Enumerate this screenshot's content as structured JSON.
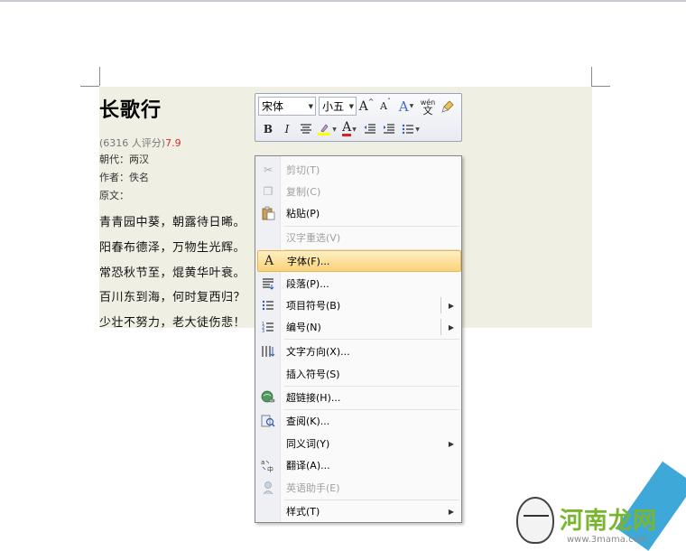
{
  "document": {
    "title": "长歌行",
    "rating_prefix": "(6316 人评分)",
    "rating_score": "7.9",
    "dynasty": "朝代：两汉",
    "author": "作者：佚名",
    "original_label": "原文：",
    "lines": [
      "青青园中葵，朝露待日晞。",
      "阳春布德泽，万物生光辉。",
      "常恐秋节至，焜黄华叶衰。",
      "百川东到海，何时复西归？",
      "少壮不努力，老大徒伤悲！"
    ]
  },
  "mini_toolbar": {
    "font_name": "宋体",
    "font_size": "小五",
    "grow_font": "A",
    "shrink_font": "A",
    "text_style": "A",
    "phonetic": "wén",
    "bold": "B",
    "italic": "I",
    "font_color_glyph": "A"
  },
  "context_menu": {
    "items": [
      {
        "label": "剪切(T)",
        "icon": "scissors-icon",
        "disabled": true
      },
      {
        "label": "复制(C)",
        "icon": "copy-icon",
        "disabled": true
      },
      {
        "label": "粘贴(P)",
        "icon": "paste-icon",
        "disabled": false
      },
      {
        "label": "汉字重选(V)",
        "icon": "",
        "disabled": true
      },
      {
        "label": "字体(F)...",
        "icon": "font-icon",
        "disabled": false,
        "hover": true
      },
      {
        "label": "段落(P)...",
        "icon": "paragraph-icon",
        "disabled": false
      },
      {
        "label": "项目符号(B)",
        "icon": "bullets-icon",
        "disabled": false,
        "submenu": true
      },
      {
        "label": "编号(N)",
        "icon": "numbering-icon",
        "disabled": false,
        "submenu": true
      },
      {
        "label": "文字方向(X)...",
        "icon": "text-direction-icon",
        "disabled": false
      },
      {
        "label": "插入符号(S)",
        "icon": "",
        "disabled": false
      },
      {
        "label": "超链接(H)...",
        "icon": "hyperlink-icon",
        "disabled": false
      },
      {
        "label": "查阅(K)...",
        "icon": "research-icon",
        "disabled": false
      },
      {
        "label": "同义词(Y)",
        "icon": "",
        "disabled": false,
        "submenu": true
      },
      {
        "label": "翻译(A)...",
        "icon": "translate-icon",
        "disabled": false
      },
      {
        "label": "英语助手(E)",
        "icon": "english-assistant-icon",
        "disabled": true
      },
      {
        "label": "样式(T)",
        "icon": "",
        "disabled": false,
        "submenu": true
      }
    ]
  },
  "watermark": {
    "brand": "河南龙网",
    "url": "www.3mama.com"
  }
}
